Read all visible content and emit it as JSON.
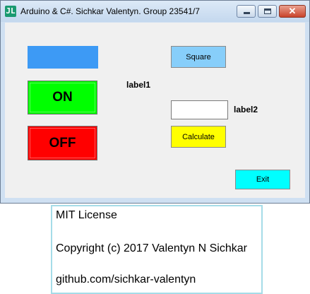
{
  "window": {
    "title": "Arduino & C#. Sichkar Valentyn. Group 23541/7",
    "icon": "app-icon",
    "icon_glyph": "JL",
    "controls": {
      "minimize": "minimize-icon",
      "maximize": "maximize-icon",
      "close": "close-icon",
      "close_glyph": "✕"
    }
  },
  "form": {
    "color_panel": {
      "color": "#3d9af5"
    },
    "on_button": {
      "label": "ON",
      "color": "#00ff00"
    },
    "off_button": {
      "label": "OFF",
      "color": "#ff0000"
    },
    "label1": "label1",
    "square_button": {
      "label": "Square",
      "color": "#87cefa"
    },
    "input": {
      "value": ""
    },
    "label2": "label2",
    "calculate_button": {
      "label": "Calculate",
      "color": "#ffff00"
    },
    "exit_button": {
      "label": "Exit",
      "color": "#00ffff"
    }
  },
  "license": {
    "line1": "MIT License",
    "line2": "Copyright (c) 2017 Valentyn N Sichkar",
    "line3": "github.com/sichkar-valentyn"
  }
}
